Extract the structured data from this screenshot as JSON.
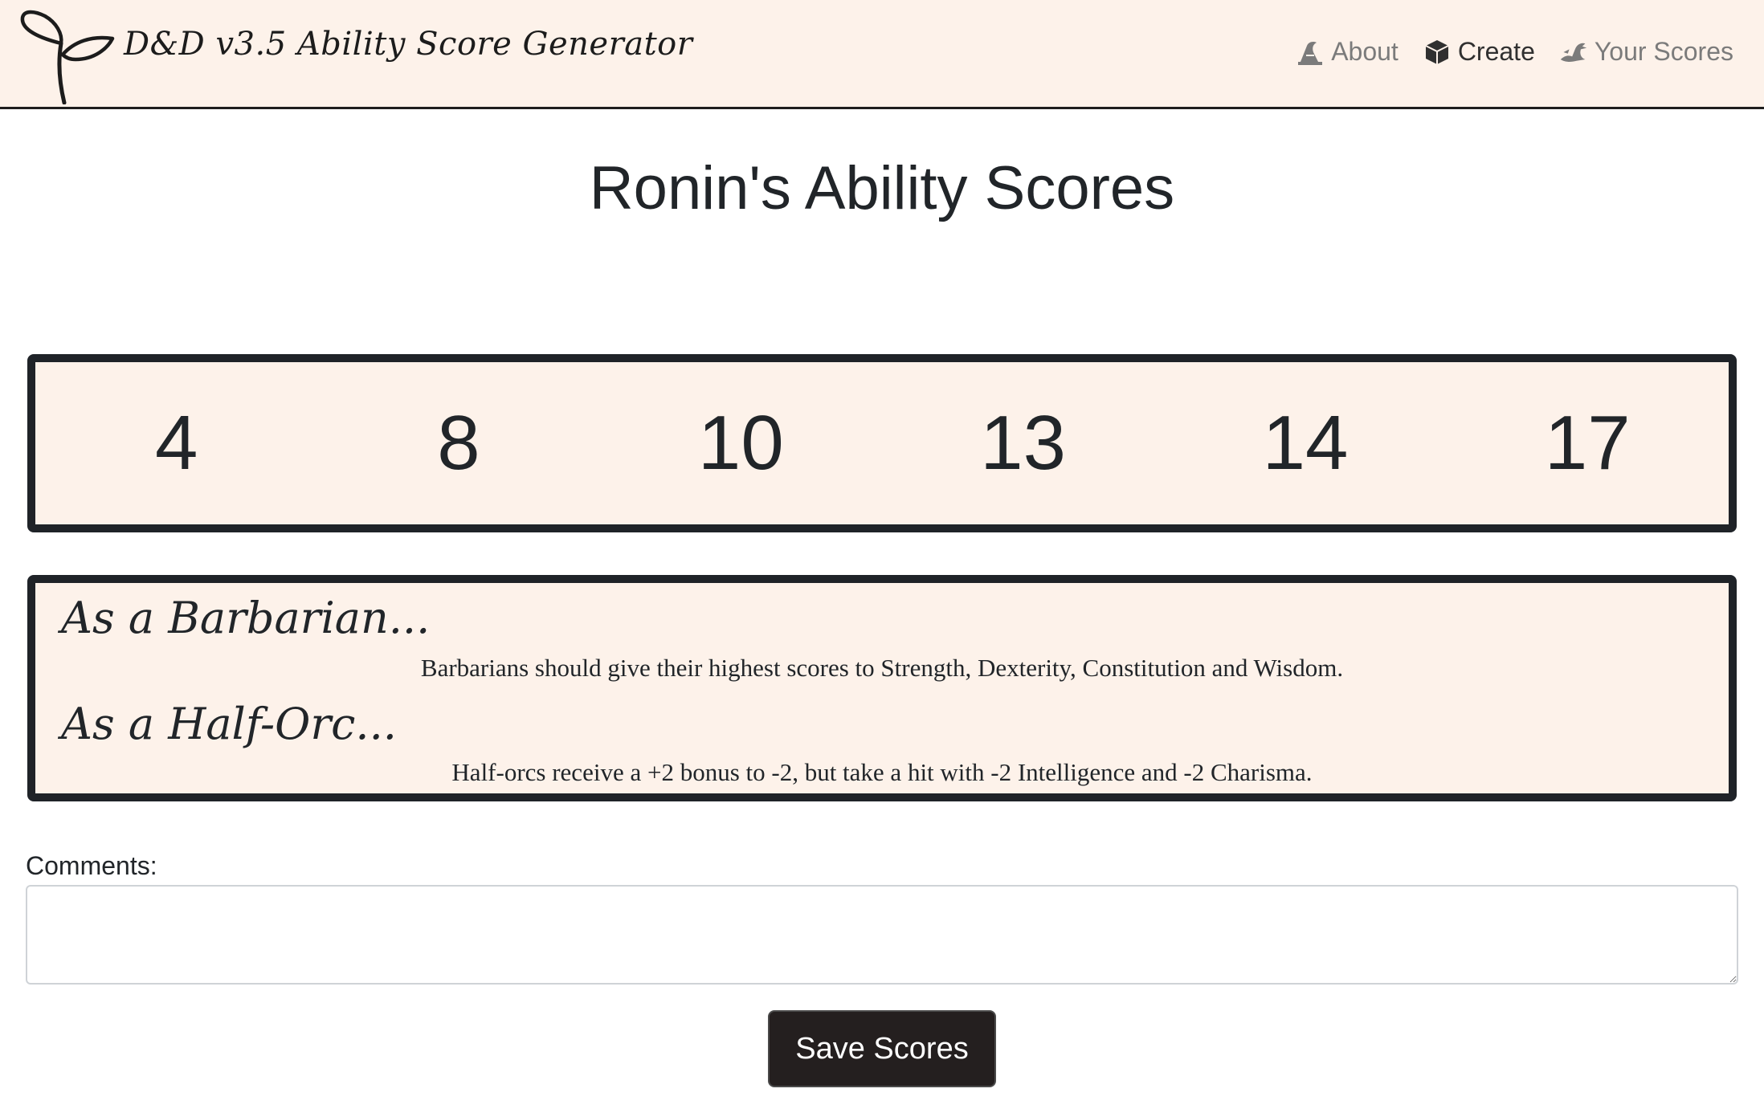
{
  "brand": {
    "title": "D&D v3.5 Ability Score Generator",
    "logo_icon": "sprout-icon"
  },
  "nav": {
    "links": [
      {
        "label": "About",
        "icon": "wizard-hat-icon",
        "active": false
      },
      {
        "label": "Create",
        "icon": "dice-icon",
        "active": true
      },
      {
        "label": "Your Scores",
        "icon": "dragon-icon",
        "active": false
      }
    ]
  },
  "page": {
    "title": "Ronin's Ability Scores"
  },
  "scores": [
    "4",
    "8",
    "10",
    "13",
    "14",
    "17"
  ],
  "advice": {
    "class_heading": "As a Barbarian...",
    "class_text": "Barbarians should give their highest scores to Strength, Dexterity, Constitution and Wisdom.",
    "race_heading": "As a Half-Orc...",
    "race_text": "Half-orcs receive a +2 bonus to -2, but take a hit with -2 Intelligence and -2 Charisma."
  },
  "comments": {
    "label": "Comments:",
    "value": "",
    "placeholder": ""
  },
  "actions": {
    "save_label": "Save Scores"
  },
  "colors": {
    "nav_background": "#fdf2ea",
    "panel_background": "#fdf2ea",
    "panel_border": "#1f2328",
    "button_background": "#241f1f",
    "nav_inactive": "#7b7b7b"
  }
}
